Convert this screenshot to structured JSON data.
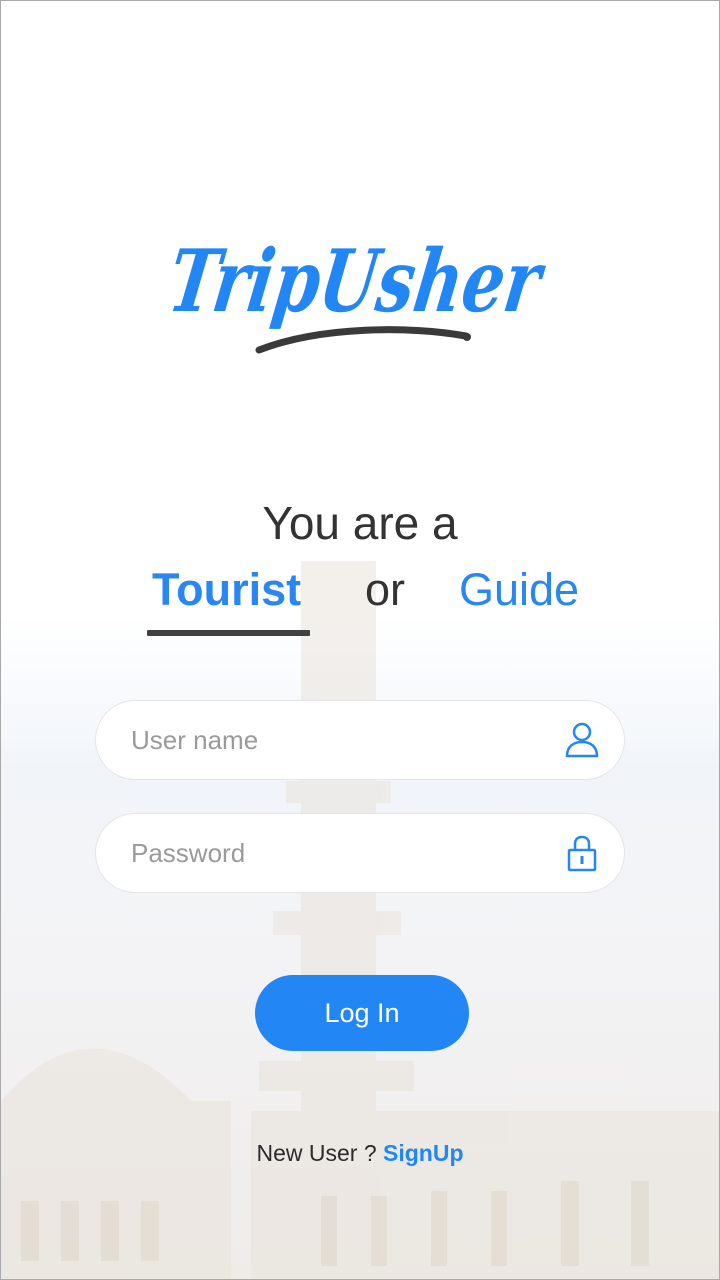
{
  "app": {
    "logo_text": "TripUsher"
  },
  "role_selector": {
    "prompt": "You are a",
    "tourist_label": "Tourist",
    "or_label": "or",
    "guide_label": "Guide",
    "selected": "Tourist"
  },
  "form": {
    "username": {
      "placeholder": "User name",
      "value": "",
      "icon": "user-icon"
    },
    "password": {
      "placeholder": "Password",
      "value": "",
      "icon": "lock-icon"
    },
    "login_label": "Log In"
  },
  "footer": {
    "question": "New User ?",
    "signup_label": "SignUp"
  },
  "colors": {
    "accent": "#2287f5",
    "text": "#333333",
    "underline": "#414141"
  }
}
